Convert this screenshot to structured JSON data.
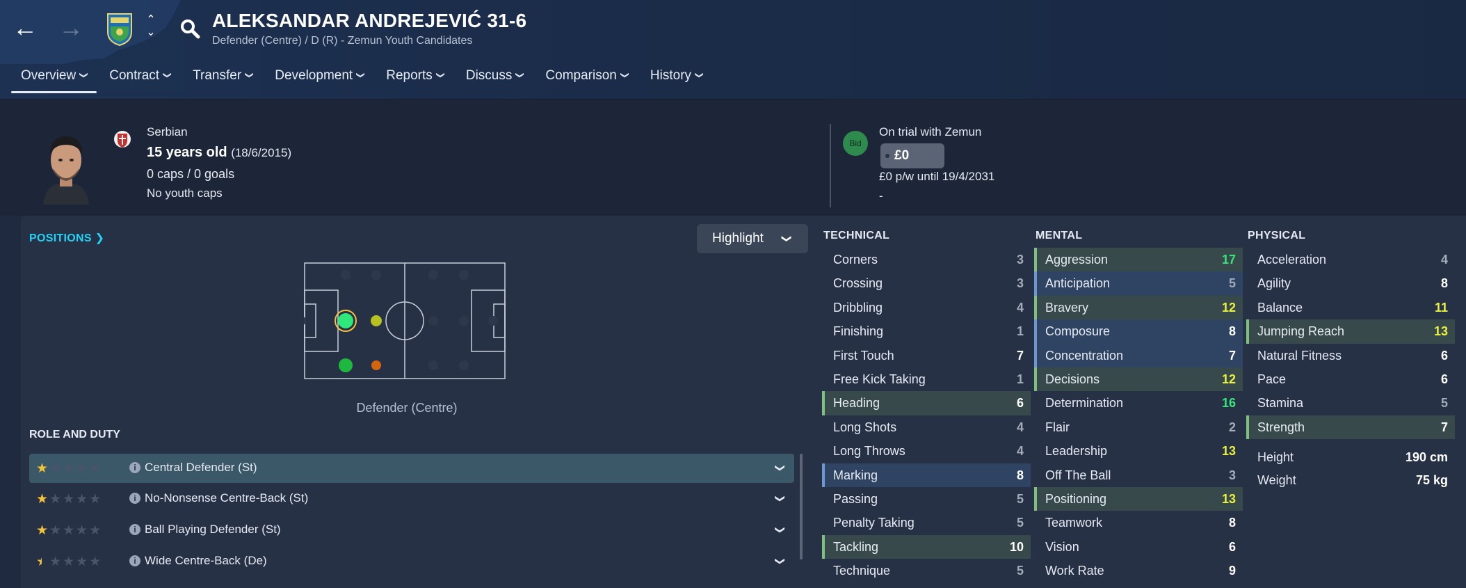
{
  "header": {
    "player_name": "ALEKSANDAR ANDREJEVIĆ 31-6",
    "subtitle": "Defender (Centre) / D (R) - Zemun Youth Candidates",
    "tabs": [
      {
        "label": "Overview",
        "active": true
      },
      {
        "label": "Contract"
      },
      {
        "label": "Transfer"
      },
      {
        "label": "Development"
      },
      {
        "label": "Reports"
      },
      {
        "label": "Discuss"
      },
      {
        "label": "Comparison"
      },
      {
        "label": "History"
      }
    ],
    "icons": [
      "back-arrow-icon",
      "forward-arrow-icon",
      "club-badge-icon",
      "up-down-icon",
      "search-icon"
    ]
  },
  "info": {
    "nationality": "Serbian",
    "age": "15 years old",
    "dob": "(18/6/2015)",
    "caps": "0 caps / 0 goals",
    "youth_caps": "No youth caps",
    "bid_label": "Bid",
    "trial_status": "On trial with Zemun",
    "value": "£0",
    "wage": "£0 p/w until 19/4/2031",
    "extra": "-"
  },
  "positions": {
    "link_label": "POSITIONS",
    "highlight_label": "Highlight",
    "pitch_label": "Defender (Centre)",
    "dot_colors": {
      "natural": "#2ee87a",
      "accomplished": "#1fb83e",
      "unconvincing": "#b7c120",
      "awkward": "#d4650f"
    }
  },
  "roles": {
    "title": "ROLE AND DUTY",
    "items": [
      {
        "name": "Central Defender (St)",
        "stars": 1,
        "selected": true
      },
      {
        "name": "No-Nonsense Centre-Back (St)",
        "stars": 1
      },
      {
        "name": "Ball Playing Defender (St)",
        "stars": 1
      },
      {
        "name": "Wide Centre-Back (De)",
        "stars": 0.5
      }
    ]
  },
  "attributes": {
    "technical": {
      "title": "TECHNICAL",
      "items": [
        {
          "name": "Corners",
          "value": "3"
        },
        {
          "name": "Crossing",
          "value": "3"
        },
        {
          "name": "Dribbling",
          "value": "4"
        },
        {
          "name": "Finishing",
          "value": "1"
        },
        {
          "name": "First Touch",
          "value": "7"
        },
        {
          "name": "Free Kick Taking",
          "value": "1"
        },
        {
          "name": "Heading",
          "value": "6"
        },
        {
          "name": "Long Shots",
          "value": "4"
        },
        {
          "name": "Long Throws",
          "value": "4"
        },
        {
          "name": "Marking",
          "value": "8"
        },
        {
          "name": "Passing",
          "value": "5"
        },
        {
          "name": "Penalty Taking",
          "value": "5"
        },
        {
          "name": "Tackling",
          "value": "10"
        },
        {
          "name": "Technique",
          "value": "5"
        }
      ]
    },
    "mental": {
      "title": "MENTAL",
      "items": [
        {
          "name": "Aggression",
          "value": "17"
        },
        {
          "name": "Anticipation",
          "value": "5"
        },
        {
          "name": "Bravery",
          "value": "12"
        },
        {
          "name": "Composure",
          "value": "8"
        },
        {
          "name": "Concentration",
          "value": "7"
        },
        {
          "name": "Decisions",
          "value": "12"
        },
        {
          "name": "Determination",
          "value": "16"
        },
        {
          "name": "Flair",
          "value": "2"
        },
        {
          "name": "Leadership",
          "value": "13"
        },
        {
          "name": "Off The Ball",
          "value": "3"
        },
        {
          "name": "Positioning",
          "value": "13"
        },
        {
          "name": "Teamwork",
          "value": "8"
        },
        {
          "name": "Vision",
          "value": "6"
        },
        {
          "name": "Work Rate",
          "value": "9"
        }
      ]
    },
    "physical": {
      "title": "PHYSICAL",
      "items": [
        {
          "name": "Acceleration",
          "value": "4"
        },
        {
          "name": "Agility",
          "value": "8"
        },
        {
          "name": "Balance",
          "value": "11"
        },
        {
          "name": "Jumping Reach",
          "value": "13"
        },
        {
          "name": "Natural Fitness",
          "value": "6"
        },
        {
          "name": "Pace",
          "value": "6"
        },
        {
          "name": "Stamina",
          "value": "5"
        },
        {
          "name": "Strength",
          "value": "7"
        }
      ],
      "height_label": "Height",
      "height": "190 cm",
      "weight_label": "Weight",
      "weight": "75 kg"
    }
  }
}
